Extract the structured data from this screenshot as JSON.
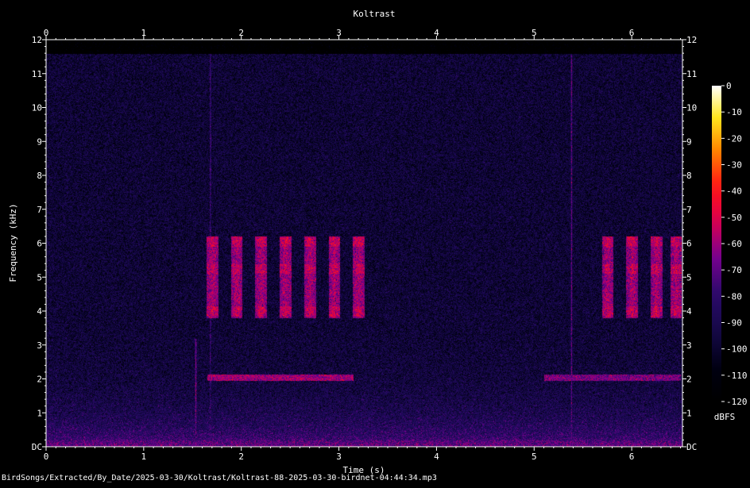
{
  "chart_data": {
    "type": "heatmap",
    "title": "Koltrast",
    "xlabel": "Time (s)",
    "ylabel": "Frequency (kHz)",
    "xlim": [
      0,
      6.52
    ],
    "ylim": [
      0,
      12
    ],
    "x_ticks": [
      "0",
      "1",
      "2",
      "3",
      "4",
      "5",
      "6"
    ],
    "y_ticks": [
      "DC",
      "1",
      "2",
      "3",
      "4",
      "5",
      "6",
      "7",
      "8",
      "9",
      "10",
      "11",
      "12"
    ],
    "colorbar": {
      "label": "dBFS",
      "range": [
        -120,
        0
      ],
      "ticks": [
        "0",
        "-10",
        "-20",
        "-30",
        "-40",
        "-50",
        "-60",
        "-70",
        "-80",
        "-90",
        "-100",
        "-110",
        "-120"
      ]
    },
    "content_top_khz": 11.6,
    "events": [
      {
        "type": "vline",
        "t": 5.38,
        "level": -70
      },
      {
        "type": "vline",
        "t": 1.68,
        "level": -78
      },
      {
        "type": "vline",
        "t": 1.53,
        "f0": 0.4,
        "f1": 3.2,
        "level": -65
      },
      {
        "type": "pulses",
        "ts": [
          1.7,
          1.95,
          2.2,
          2.45,
          2.7,
          2.95,
          3.2
        ],
        "f_range": [
          3.8,
          6.2
        ],
        "level": -58
      },
      {
        "type": "pulses",
        "ts": [
          5.75,
          6.0,
          6.25,
          6.45
        ],
        "f_range": [
          3.8,
          6.2
        ],
        "level": -58
      },
      {
        "type": "tone",
        "t0": 1.65,
        "t1": 3.15,
        "f": 2.05,
        "level": -60
      },
      {
        "type": "tone",
        "t0": 5.1,
        "t1": 6.5,
        "f": 2.05,
        "level": -66
      }
    ]
  },
  "footer": {
    "path": "BirdSongs/Extracted/By_Date/2025-03-30/Koltrast/Koltrast-88-2025-03-30-birdnet-04:44:34.mp3"
  },
  "colors": {
    "background": "#000000",
    "low": "#000010",
    "mid_low": "#2a0a6a",
    "mid": "#7a0090",
    "mid_high": "#e0004a",
    "high": "#ff8800",
    "top": "#ffffff"
  }
}
